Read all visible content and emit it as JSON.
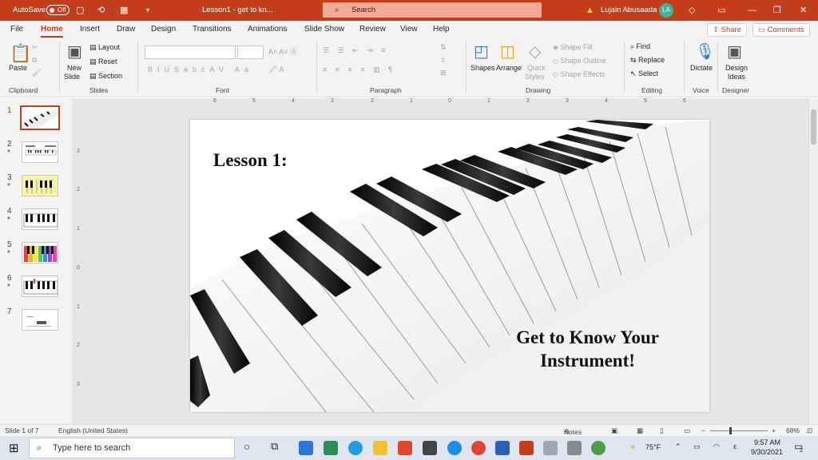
{
  "titlebar": {
    "autosave_label": "AutoSave",
    "autosave_state": "Off",
    "doc_title": "Lesson1 - get to kn...",
    "search_placeholder": "Search",
    "user_name": "Lujain Abusaada",
    "user_initials": "LA"
  },
  "tabs": [
    "File",
    "Home",
    "Insert",
    "Draw",
    "Design",
    "Transitions",
    "Animations",
    "Slide Show",
    "Review",
    "View",
    "Help"
  ],
  "active_tab": "Home",
  "share_label": "Share",
  "comments_label": "Comments",
  "ribbon": {
    "clipboard": {
      "paste": "Paste",
      "group": "Clipboard"
    },
    "slides": {
      "new_slide_1": "New",
      "new_slide_2": "Slide",
      "layout": "Layout",
      "reset": "Reset",
      "section": "Section",
      "group": "Slides"
    },
    "font": {
      "group": "Font"
    },
    "paragraph": {
      "group": "Paragraph"
    },
    "drawing": {
      "shapes": "Shapes",
      "arrange": "Arrange",
      "quick_styles_1": "Quick",
      "quick_styles_2": "Styles",
      "shape_fill": "Shape Fill",
      "shape_outline": "Shape Outline",
      "shape_effects": "Shape Effects",
      "group": "Drawing"
    },
    "editing": {
      "find": "Find",
      "replace": "Replace",
      "select": "Select",
      "group": "Editing"
    },
    "voice": {
      "dictate": "Dictate",
      "group": "Voice"
    },
    "designer": {
      "ideas_1": "Design",
      "ideas_2": "Ideas",
      "group": "Designer"
    }
  },
  "ruler_h": [
    "6",
    "5",
    "4",
    "3",
    "2",
    "1",
    "0",
    "1",
    "2",
    "3",
    "4",
    "5",
    "6"
  ],
  "ruler_v": [
    "3",
    "2",
    "1",
    "0",
    "1",
    "2",
    "3"
  ],
  "slides": [
    {
      "num": "1",
      "star": ""
    },
    {
      "num": "2",
      "star": "*"
    },
    {
      "num": "3",
      "star": "*"
    },
    {
      "num": "4",
      "star": "*"
    },
    {
      "num": "5",
      "star": "*"
    },
    {
      "num": "6",
      "star": "*"
    },
    {
      "num": "7",
      "star": ""
    }
  ],
  "slide": {
    "title": "Lesson 1:",
    "subtitle_line1": "Get to Know Your",
    "subtitle_line2": "Instrument!"
  },
  "statusbar": {
    "slide_count": "Slide 1 of 7",
    "language": "English (United States)",
    "notes": "Notes",
    "zoom": "68%"
  },
  "taskbar": {
    "search_placeholder": "Type here to search",
    "weather": "75°F",
    "time": "9:57 AM",
    "date": "9/30/2021",
    "notifications": "2"
  },
  "colors": {
    "accent": "#c43e1c",
    "taskbar": "#dfe6ef"
  }
}
